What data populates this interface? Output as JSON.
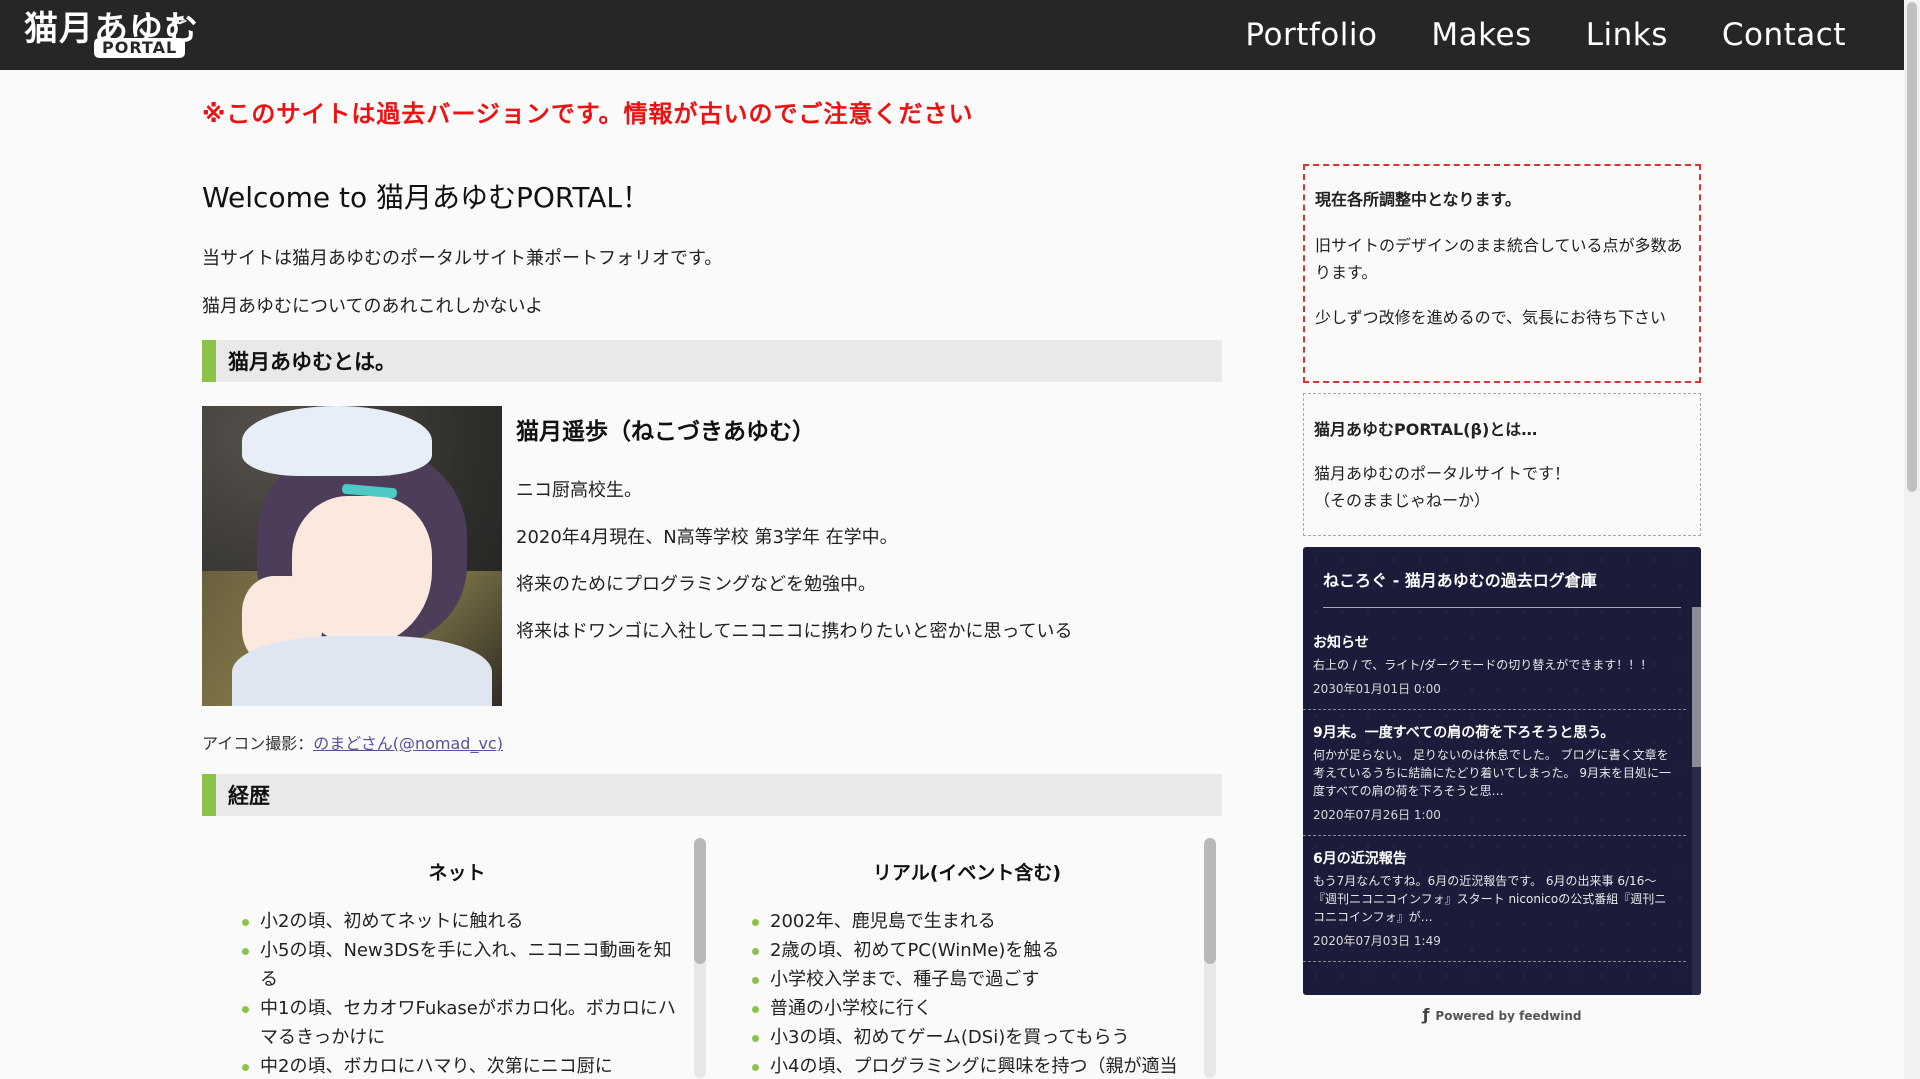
{
  "header": {
    "logo_main": "猫月あゆむ",
    "logo_sub": "PORTAL",
    "nav": [
      "Portfolio",
      "Makes",
      "Links",
      "Contact"
    ]
  },
  "notice": "※このサイトは過去バージョンです。情報が古いのでご注意ください",
  "main": {
    "title": "Welcome to 猫月あゆむPORTAL！",
    "lead1": "当サイトは猫月あゆむのポータルサイト兼ポートフォリオです。",
    "lead2": "猫月あゆむについてのあれこれしかないよ",
    "section_about": "猫月あゆむとは。",
    "profile": {
      "name": "猫月遥歩（ねこづきあゆむ）",
      "lines": [
        "ニコ厨高校生。",
        "2020年4月現在、N高等学校 第3学年 在学中。",
        "将来のためにプログラミングなどを勉強中。",
        "将来はドワンゴに入社してニコニコに携わりたいと密かに思っている"
      ]
    },
    "credit_label": "アイコン撮影：",
    "credit_link": "のまどさん(@nomad_vc)",
    "section_history": "経歴",
    "net": {
      "title": "ネット",
      "items": [
        "小2の頃、初めてネットに触れる",
        "小5の頃、New3DSを手に入れ、ニコニコ動画を知る",
        "中1の頃、セカオワFukaseがボカロ化。ボカロにハマるきっかけに",
        "中2の頃、ボカロにハマり、次第にニコ厨に"
      ]
    },
    "real": {
      "title": "リアル(イベント含む)",
      "items": [
        "2002年、鹿児島で生まれる",
        "2歳の頃、初めてPC(WinMe)を触る",
        "小学校入学まで、種子島で過ごす",
        "普通の小学校に行く",
        "小3の頃、初めてゲーム(DSi)を買ってもらう",
        "小4の頃、プログラミングに興味を持つ（親が適当"
      ]
    }
  },
  "sidebar": {
    "red_box": {
      "title": "現在各所調整中となります。",
      "p1": "旧サイトのデザインのまま統合している点が多数あります。",
      "p2": "少しずつ改修を進めるので、気長にお待ち下さい"
    },
    "gray_box": {
      "title": "猫月あゆむPORTAL(β)とは…",
      "p1": "猫月あゆむのポータルサイトです！",
      "p2": "（そのままじゃねーか）"
    },
    "feed": {
      "title": "ねころぐ - 猫月あゆむの過去ログ倉庫",
      "items": [
        {
          "title": "お知らせ",
          "desc": "右上の / で、ライト/ダークモードの切り替えができます！！！",
          "date": "2030年01月01日 0:00"
        },
        {
          "title": "9月末。一度すべての肩の荷を下ろそうと思う。",
          "desc": "何かが足らない。 足りないのは休息でした。 ブログに書く文章を考えているうちに結論にたどり着いてしまった。 9月末を目処に一度すべての肩の荷を下ろそうと思…",
          "date": "2020年07月26日 1:00"
        },
        {
          "title": "6月の近況報告",
          "desc": "もう7月なんですね。6月の近況報告です。 6月の出来事 6/16～『週刊ニコニコインフォ』スタート niconicoの公式番組『週刊ニコニコインフォ』が…",
          "date": "2020年07月03日 1:49"
        }
      ],
      "powered": "Powered by feedwind"
    }
  }
}
